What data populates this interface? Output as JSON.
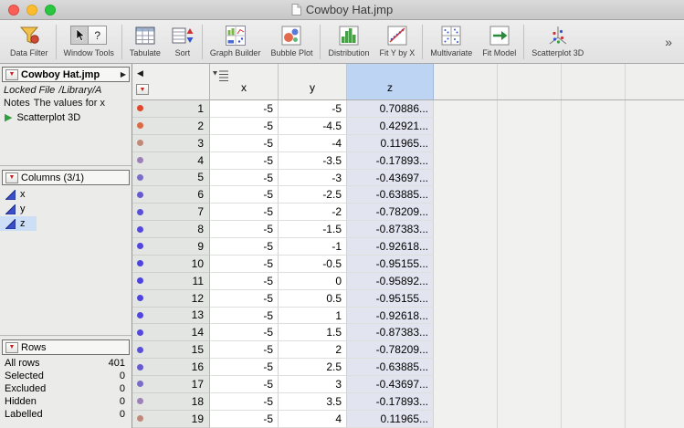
{
  "window": {
    "title": "Cowboy Hat.jmp"
  },
  "glyphs": {
    "collapse_left": "◀",
    "expand_right": "▶",
    "red_triangle": "▼",
    "script_run": "▶",
    "overflow": "»"
  },
  "toolbar": {
    "overflow_label": "»",
    "items": [
      {
        "label": "Data Filter"
      },
      {
        "label": "Window Tools",
        "help_glyph": "?"
      },
      {
        "label": "Tabulate"
      },
      {
        "label": "Sort"
      },
      {
        "label": "Graph Builder"
      },
      {
        "label": "Bubble Plot"
      },
      {
        "label": "Distribution"
      },
      {
        "label": "Fit Y by X"
      },
      {
        "label": "Multivariate"
      },
      {
        "label": "Fit Model"
      },
      {
        "label": "Scatterplot 3D"
      }
    ]
  },
  "sidebar": {
    "table_panel": {
      "title": "Cowboy Hat.jmp",
      "locked_label": "Locked File",
      "locked_path": "/Library/A",
      "notes_label": "Notes",
      "notes_value": "The values for x",
      "script_label": "Scatterplot 3D"
    },
    "columns_panel": {
      "title": "Columns (3/1)",
      "items": [
        {
          "name": "x",
          "selected": false
        },
        {
          "name": "y",
          "selected": false
        },
        {
          "name": "z",
          "selected": true
        }
      ]
    },
    "rows_panel": {
      "title": "Rows",
      "stats": [
        {
          "label": "All rows",
          "value": "401"
        },
        {
          "label": "Selected",
          "value": "0"
        },
        {
          "label": "Excluded",
          "value": "0"
        },
        {
          "label": "Hidden",
          "value": "0"
        },
        {
          "label": "Labelled",
          "value": "0"
        }
      ]
    }
  },
  "table": {
    "columns": [
      "x",
      "y",
      "z"
    ],
    "selected_column": "z",
    "rows": [
      {
        "n": "1",
        "x": "-5",
        "y": "-5",
        "z": "0.70886...",
        "marker": "#e0482c"
      },
      {
        "n": "2",
        "x": "-5",
        "y": "-4.5",
        "z": "0.42921...",
        "marker": "#dd6a46"
      },
      {
        "n": "3",
        "x": "-5",
        "y": "-4",
        "z": "0.11965...",
        "marker": "#c08a7a"
      },
      {
        "n": "4",
        "x": "-5",
        "y": "-3.5",
        "z": "-0.17893...",
        "marker": "#9d80b6"
      },
      {
        "n": "5",
        "x": "-5",
        "y": "-3",
        "z": "-0.43697...",
        "marker": "#7b6cc9"
      },
      {
        "n": "6",
        "x": "-5",
        "y": "-2.5",
        "z": "-0.63885...",
        "marker": "#6659d2"
      },
      {
        "n": "7",
        "x": "-5",
        "y": "-2",
        "z": "-0.78209...",
        "marker": "#5a50d8"
      },
      {
        "n": "8",
        "x": "-5",
        "y": "-1.5",
        "z": "-0.87383...",
        "marker": "#5449dc"
      },
      {
        "n": "9",
        "x": "-5",
        "y": "-1",
        "z": "-0.92618...",
        "marker": "#5045de"
      },
      {
        "n": "10",
        "x": "-5",
        "y": "-0.5",
        "z": "-0.95155...",
        "marker": "#4e43df"
      },
      {
        "n": "11",
        "x": "-5",
        "y": "0",
        "z": "-0.95892...",
        "marker": "#4d42df"
      },
      {
        "n": "12",
        "x": "-5",
        "y": "0.5",
        "z": "-0.95155...",
        "marker": "#4e43df"
      },
      {
        "n": "13",
        "x": "-5",
        "y": "1",
        "z": "-0.92618...",
        "marker": "#5045de"
      },
      {
        "n": "14",
        "x": "-5",
        "y": "1.5",
        "z": "-0.87383...",
        "marker": "#5449dc"
      },
      {
        "n": "15",
        "x": "-5",
        "y": "2",
        "z": "-0.78209...",
        "marker": "#5a50d8"
      },
      {
        "n": "16",
        "x": "-5",
        "y": "2.5",
        "z": "-0.63885...",
        "marker": "#6659d2"
      },
      {
        "n": "17",
        "x": "-5",
        "y": "3",
        "z": "-0.43697...",
        "marker": "#7b6cc9"
      },
      {
        "n": "18",
        "x": "-5",
        "y": "3.5",
        "z": "-0.17893...",
        "marker": "#9d80b6"
      },
      {
        "n": "19",
        "x": "-5",
        "y": "4",
        "z": "0.11965...",
        "marker": "#c08a7a"
      }
    ]
  },
  "colors": {
    "z_header_highlight": "#bdd4f2",
    "z_cell_highlight": "#e2e5f0",
    "selection_blue": "#cddff6",
    "red_triangle": "#cc1f1f",
    "script_green": "#2f9e3f",
    "column_icon_blue": "#3b50c8"
  }
}
